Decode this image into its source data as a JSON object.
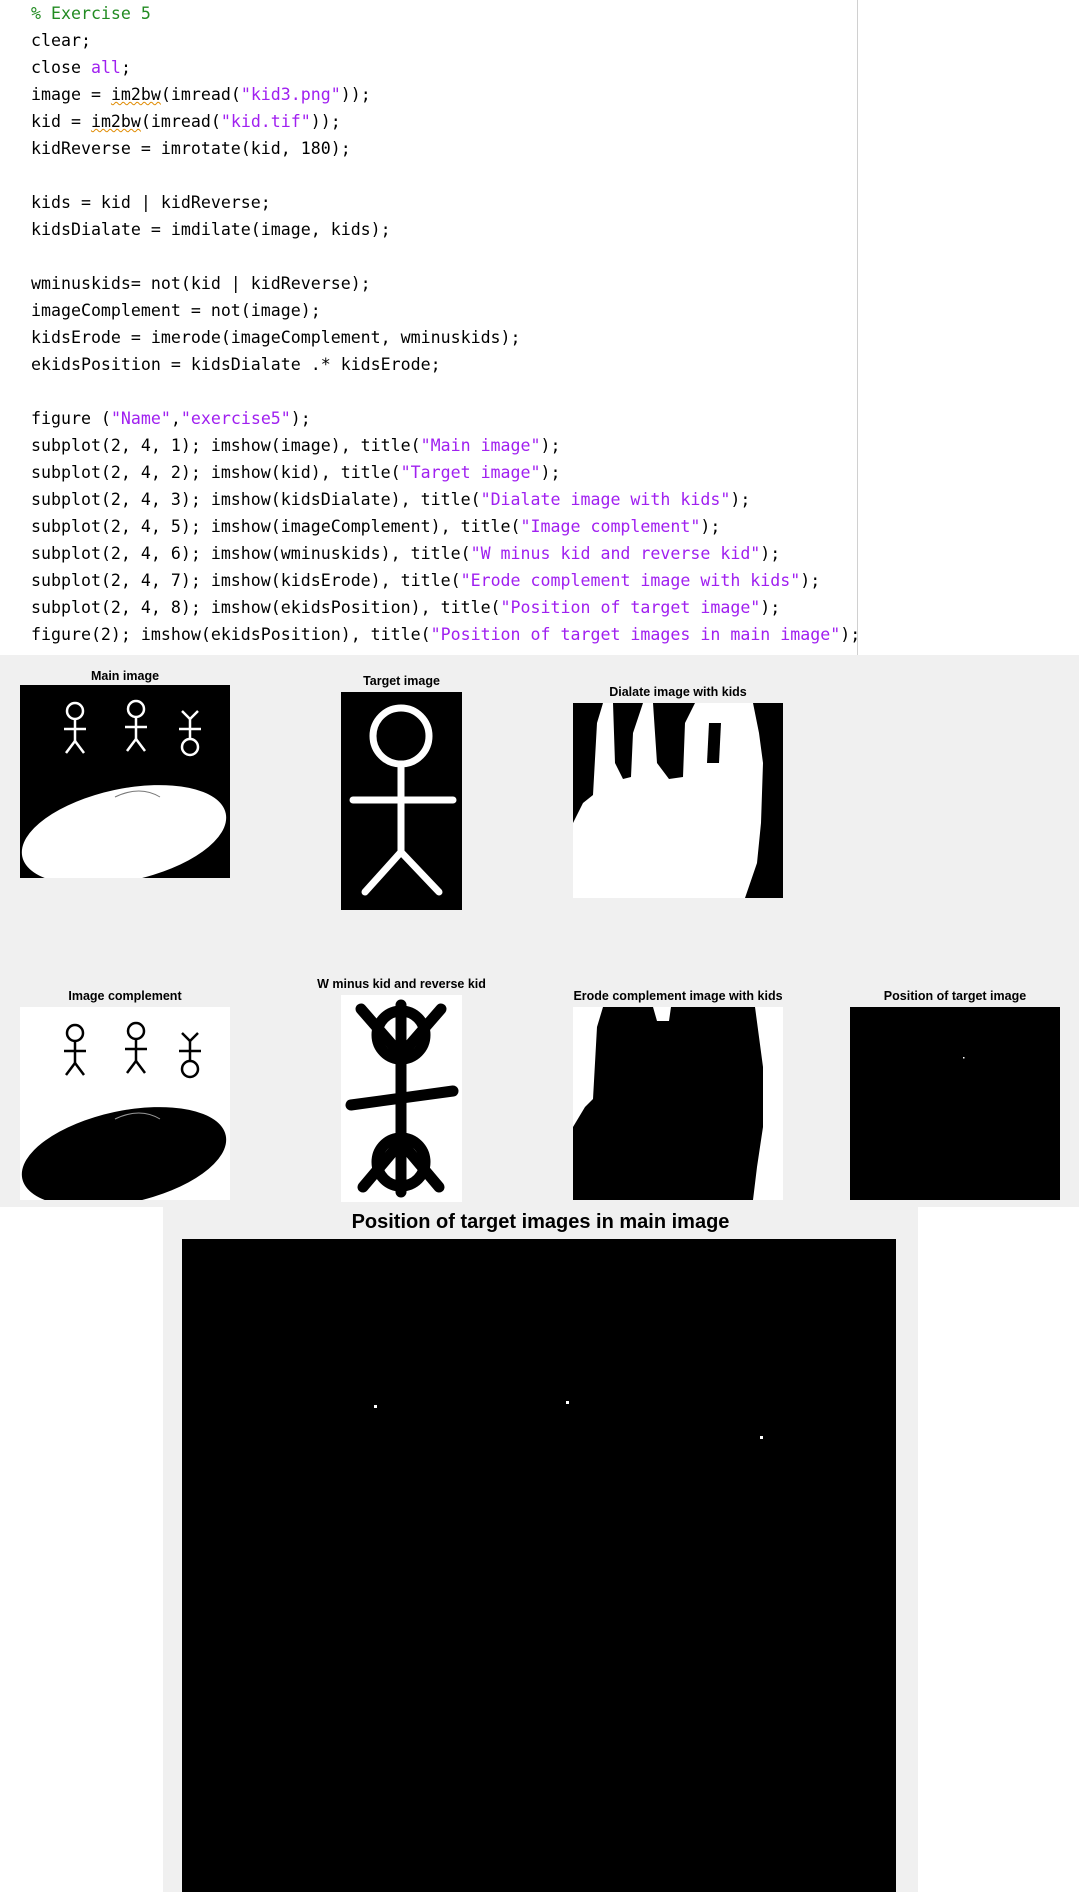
{
  "editor": {
    "lines": [
      [
        {
          "t": "% Exercise 5",
          "c": "comment"
        }
      ],
      [
        {
          "t": "clear;"
        }
      ],
      [
        {
          "t": "close "
        },
        {
          "t": "all",
          "c": "keyword"
        },
        {
          "t": ";"
        }
      ],
      [
        {
          "t": "image = "
        },
        {
          "t": "im2bw",
          "c": "warn"
        },
        {
          "t": "(imread("
        },
        {
          "t": "\"kid3.png\"",
          "c": "string"
        },
        {
          "t": "));"
        }
      ],
      [
        {
          "t": "kid = "
        },
        {
          "t": "im2bw",
          "c": "warn"
        },
        {
          "t": "(imread("
        },
        {
          "t": "\"kid.tif\"",
          "c": "string"
        },
        {
          "t": "));"
        }
      ],
      [
        {
          "t": "kidReverse = imrotate(kid, 180);"
        }
      ],
      [
        {
          "t": ""
        }
      ],
      [
        {
          "t": "kids = kid | kidReverse;"
        }
      ],
      [
        {
          "t": "kidsDialate = imdilate(image, kids);"
        }
      ],
      [
        {
          "t": ""
        }
      ],
      [
        {
          "t": "wminuskids= not(kid | kidReverse);"
        }
      ],
      [
        {
          "t": "imageComplement = not(image);"
        }
      ],
      [
        {
          "t": "kidsErode = imerode(imageComplement, wminuskids);"
        }
      ],
      [
        {
          "t": "ekidsPosition = kidsDialate .* kidsErode;"
        }
      ],
      [
        {
          "t": ""
        }
      ],
      [
        {
          "t": "figure ("
        },
        {
          "t": "\"Name\"",
          "c": "string"
        },
        {
          "t": ","
        },
        {
          "t": "\"exercise5\"",
          "c": "string"
        },
        {
          "t": ");"
        }
      ],
      [
        {
          "t": "subplot(2, 4, 1); imshow(image), title("
        },
        {
          "t": "\"Main image\"",
          "c": "string"
        },
        {
          "t": ");"
        }
      ],
      [
        {
          "t": "subplot(2, 4, 2); imshow(kid), title("
        },
        {
          "t": "\"Target image\"",
          "c": "string"
        },
        {
          "t": ");"
        }
      ],
      [
        {
          "t": "subplot(2, 4, 3); imshow(kidsDialate), title("
        },
        {
          "t": "\"Dialate image with kids\"",
          "c": "string"
        },
        {
          "t": ");"
        }
      ],
      [
        {
          "t": "subplot(2, 4, 5); imshow(imageComplement), title("
        },
        {
          "t": "\"Image complement\"",
          "c": "string"
        },
        {
          "t": ");"
        }
      ],
      [
        {
          "t": "subplot(2, 4, 6); imshow(wminuskids), title("
        },
        {
          "t": "\"W minus kid and reverse kid\"",
          "c": "string"
        },
        {
          "t": ");"
        }
      ],
      [
        {
          "t": "subplot(2, 4, 7); imshow(kidsErode), title("
        },
        {
          "t": "\"Erode complement image with kids\"",
          "c": "string"
        },
        {
          "t": ");"
        }
      ],
      [
        {
          "t": "subplot(2, 4, 8); imshow(ekidsPosition), title("
        },
        {
          "t": "\"Position of target image\"",
          "c": "string"
        },
        {
          "t": ");"
        }
      ],
      [
        {
          "t": "figure(2); imshow(ekidsPosition), title("
        },
        {
          "t": "\"Position of target images in main image\"",
          "c": "string"
        },
        {
          "t": ");"
        }
      ]
    ]
  },
  "figure1": {
    "subplots": [
      {
        "id": "main-image",
        "title": "Main image"
      },
      {
        "id": "target-image",
        "title": "Target image"
      },
      {
        "id": "dialate-image",
        "title": "Dialate image with kids"
      },
      {
        "id": "image-complement",
        "title": "Image complement"
      },
      {
        "id": "w-minus-kid",
        "title": "W minus kid and reverse kid"
      },
      {
        "id": "erode-complement",
        "title": "Erode complement image with kids"
      },
      {
        "id": "position-target",
        "title": "Position of target image"
      }
    ]
  },
  "figure2": {
    "title": "Position of target images in main image"
  },
  "colors": {
    "comment": "#228B22",
    "string": "#A020F0",
    "keyword": "#A020F0",
    "figure_background": "#f0f0f0"
  }
}
